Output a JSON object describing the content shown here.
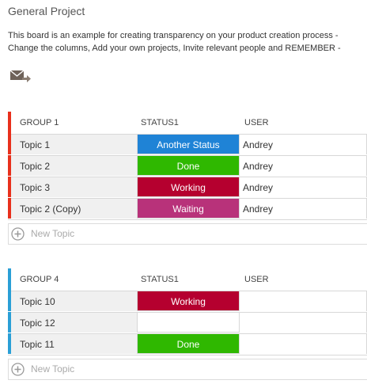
{
  "board": {
    "title": "General Project",
    "description_line1": "This board is an example for creating transparency on your product creation process -",
    "description_line2": "Change the columns, Add your own projects, Invite relevant people and REMEMBER -",
    "mail_icon": "mail-forward-icon"
  },
  "groups": [
    {
      "name": "GROUP 1",
      "status_header": "STATUS1",
      "user_header": "USER",
      "color": "#e8301c",
      "rows": [
        {
          "topic": "Topic 1",
          "status": "Another Status",
          "status_color": "#1f83d6",
          "user": "Andrey"
        },
        {
          "topic": "Topic 2",
          "status": "Done",
          "status_color": "#2fb800",
          "user": "Andrey"
        },
        {
          "topic": "Topic 3",
          "status": "Working",
          "status_color": "#b5002f",
          "user": "Andrey"
        },
        {
          "topic": "Topic 2 (Copy)",
          "status": "Waiting",
          "status_color": "#b8327a",
          "user": "Andrey"
        }
      ],
      "new_topic_placeholder": "New Topic"
    },
    {
      "name": "GROUP 4",
      "status_header": "STATUS1",
      "user_header": "USER",
      "color": "#2a9fd6",
      "rows": [
        {
          "topic": "Topic 10",
          "status": "Working",
          "status_color": "#b5002f",
          "user": ""
        },
        {
          "topic": "Topic 12",
          "status": "",
          "status_color": "#ffffff",
          "user": ""
        },
        {
          "topic": "Topic 11",
          "status": "Done",
          "status_color": "#2fb800",
          "user": ""
        }
      ],
      "new_topic_placeholder": "New Topic"
    }
  ]
}
